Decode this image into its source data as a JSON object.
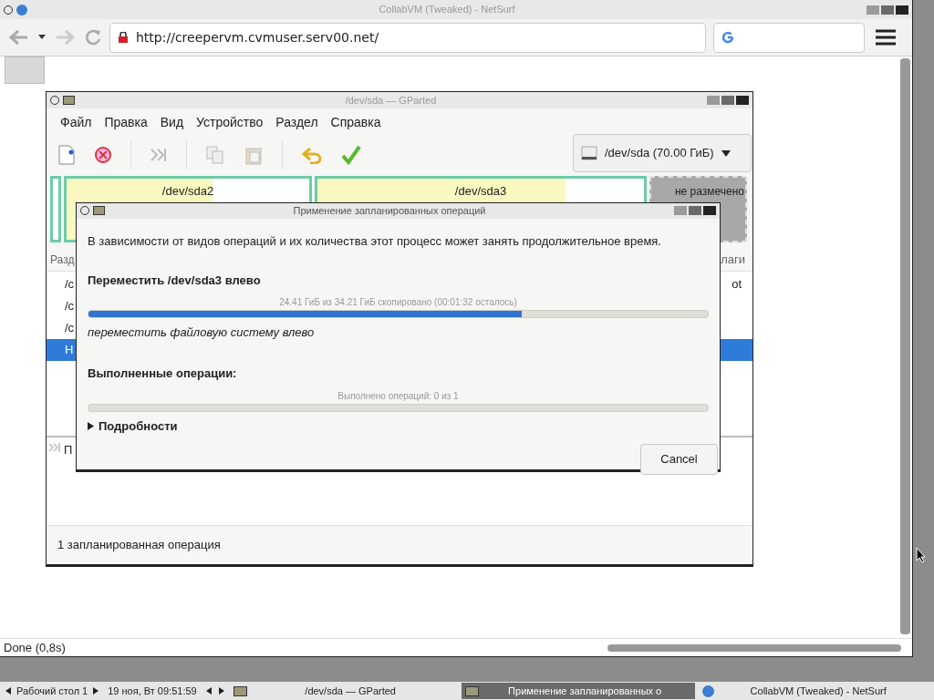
{
  "browser": {
    "title": "CollabVM (Tweaked) - NetSurf",
    "url": "http://creepervm.cvmuser.serv00.net/",
    "status": "Done (0,8s)"
  },
  "gparted": {
    "title": "/dev/sda — GParted",
    "menu": [
      "Файл",
      "Правка",
      "Вид",
      "Устройство",
      "Раздел",
      "Справка"
    ],
    "device": "/dev/sda (70.00 ГиБ)",
    "partitions": [
      {
        "label": "/dev/sda2",
        "kind": "used",
        "level": 0.6
      },
      {
        "label": "/dev/sda3",
        "kind": "used",
        "level": 0.76
      },
      {
        "label": "не размечено",
        "kind": "unallocated"
      }
    ],
    "columns": [
      {
        "label": "Разд"
      },
      {
        "label": "лаги"
      }
    ],
    "rows": [
      {
        "cell": "/c",
        "flags": "ot",
        "selected": false
      },
      {
        "cell": "/c",
        "selected": false
      },
      {
        "cell": "/c",
        "selected": false
      },
      {
        "cell": "Н",
        "selected": true
      }
    ],
    "pending_item": "П",
    "status": "1 запланированная операция"
  },
  "dialog": {
    "title": "Применение запланированных операций",
    "intro": "В зависимости от видов операций и их количества этот процесс может занять продолжительное время.",
    "operation": "Переместить /dev/sda3 влево",
    "progress_text": "24.41 ГиБ из 34.21 ГиБ скопировано (00:01:32 осталось)",
    "progress": {
      "level": 0.7
    },
    "step": "переместить файловую систему влево",
    "completed_label": "Выполненные операции:",
    "completed_text": "Выполнено операций: 0 из 1",
    "completed": {
      "level": 0
    },
    "details": {
      "label": "Подробности",
      "expanded": false
    },
    "cancel": "Cancel"
  },
  "taskbar": {
    "desktop": "Рабочий стол 1",
    "clock": "19 ноя, Вт 09:51:59",
    "tasks": [
      {
        "label": "/dev/sda — GParted",
        "selected": false
      },
      {
        "label": "Применение запланированных о",
        "selected": true
      },
      {
        "label": "CollabVM (Tweaked) - NetSurf",
        "selected": false
      }
    ]
  }
}
